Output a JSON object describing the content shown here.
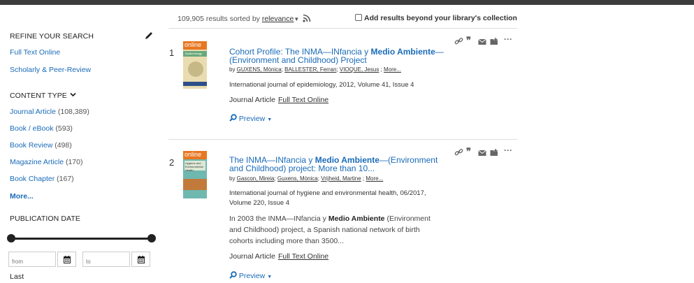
{
  "sidebar": {
    "refine_heading": "REFINE YOUR SEARCH",
    "refine_links": [
      "Full Text Online",
      "Scholarly & Peer-Review"
    ],
    "content_type_heading": "CONTENT TYPE",
    "content_types": [
      {
        "label": "Journal Article",
        "count": "(108,389)"
      },
      {
        "label": "Book / eBook",
        "count": "(593)"
      },
      {
        "label": "Book Review",
        "count": "(498)"
      },
      {
        "label": "Magazine Article",
        "count": "(170)"
      },
      {
        "label": "Book Chapter",
        "count": "(167)"
      }
    ],
    "more_label": "More...",
    "pubdate_heading": "PUBLICATION DATE",
    "from_placeholder": "from",
    "to_placeholder": "to",
    "last_label": "Last"
  },
  "results_bar": {
    "count_text": "109,905 results sorted by",
    "sort_label": "relevance",
    "add_beyond_label": "Add results beyond your library's collection"
  },
  "results": [
    {
      "num": "1",
      "badge": "online",
      "cover_title": "Epidemiology",
      "title_pre": "Cohort Profile: The INMA—INfancia y ",
      "title_bold": "Medio Ambiente",
      "title_post": "—(Environment and Childhood) Project",
      "authors": [
        "GUXENS, Mònica",
        "BALLESTER, Ferran",
        "VIOQUE, Jesus"
      ],
      "authors_more": "More...",
      "publication": "International journal of epidemiology, 2012, Volume 41, Issue 4",
      "type": "Journal Article",
      "fulltext": "Full Text Online",
      "preview": "Preview"
    },
    {
      "num": "2",
      "badge": "online",
      "cover_title": "Hygiene and Environmental Health",
      "title_pre": "The INMA—INfancia y ",
      "title_bold": "Medio Ambiente",
      "title_post": "—(Environment and Childhood) project: More than 10...",
      "authors": [
        "Gascon, Mireia",
        "Guxens, Mònica",
        "Vrijheid, Martine"
      ],
      "authors_more": "More...",
      "publication": "International journal of hygiene and environmental health, 06/2017, Volume 220, Issue 4",
      "abstract_pre": "In 2003 the INMA—INfancia y ",
      "abstract_bold": "Medio Ambiente",
      "abstract_post": " (Environment and Childhood) project, a Spanish national network of birth cohorts including more than 3500...",
      "type": "Journal Article",
      "fulltext": "Full Text Online",
      "preview": "Preview"
    }
  ],
  "icons": {
    "actions": [
      "link-icon",
      "quote-icon",
      "email-icon",
      "folder-add-icon",
      "more-icon"
    ]
  },
  "colors": {
    "link": "#1a6bb8",
    "badge": "#e87722",
    "topbar": "#3c3c3c"
  }
}
